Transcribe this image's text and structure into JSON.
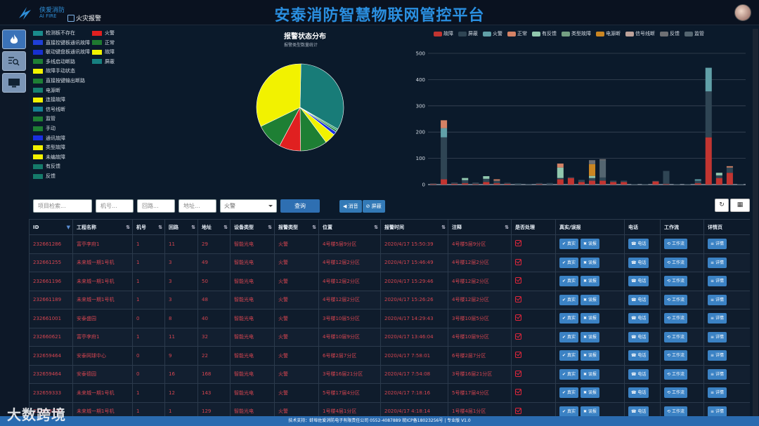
{
  "header": {
    "brand_line1": "侠爱消防",
    "brand_line2": "AI FIRE",
    "fire_alarm": "火灾报警",
    "title": "安泰消防智慧物联网管控平台"
  },
  "sidebar": {
    "items": [
      {
        "icon": "fire-icon",
        "active": true
      },
      {
        "icon": "list-search-icon",
        "active": false
      },
      {
        "icon": "monitor-icon",
        "active": false
      }
    ]
  },
  "pie_legend": [
    {
      "label": "检测板不存在",
      "color": "#1a8c8c"
    },
    {
      "label": "火警",
      "color": "#e02020"
    },
    {
      "label": "直接控键板通讯故障",
      "color": "#1f3fd6"
    },
    {
      "label": "正常",
      "color": "#1f7a30"
    },
    {
      "label": "联动键盘板通讯故障",
      "color": "#1730d0"
    },
    {
      "label": "故障",
      "color": "#f2f200"
    },
    {
      "label": "多线启动断路",
      "color": "#1e7f34"
    },
    {
      "label": "屏蔽",
      "color": "#178080"
    },
    {
      "label": "故障手动状态",
      "color": "#f2f200"
    },
    {
      "label": "直接按键输出断路",
      "color": "#1e7f34"
    },
    {
      "label": "电源断",
      "color": "#178070"
    },
    {
      "label": "连接故障",
      "color": "#f2f200"
    },
    {
      "label": "信号线断",
      "color": "#158090"
    },
    {
      "label": "监管",
      "color": "#1e7f34"
    },
    {
      "label": "手动",
      "color": "#1e7f34"
    },
    {
      "label": "通讯故障",
      "color": "#1a2fe0"
    },
    {
      "label": "类型故障",
      "color": "#f2f200"
    },
    {
      "label": "未编故障",
      "color": "#f2f200"
    },
    {
      "label": "有反馈",
      "color": "#157a6a"
    },
    {
      "label": "反馈",
      "color": "#157a6a"
    }
  ],
  "pie": {
    "title": "报警状态分布",
    "subtitle": "报警类型数量统计",
    "slices": [
      {
        "name": "屏蔽",
        "value": 33,
        "color": "#187c78"
      },
      {
        "name": "监管",
        "value": 0.6,
        "color": "#2aa060"
      },
      {
        "name": "正常",
        "value": 0.7,
        "color": "#1e7f34"
      },
      {
        "name": "通讯故障",
        "value": 1.2,
        "color": "#1a2fe0"
      },
      {
        "name": "故障",
        "value": 4,
        "color": "#f2f200"
      },
      {
        "name": "直接按键输出断路",
        "value": 10,
        "color": "#1e7f34"
      },
      {
        "name": "火警",
        "value": 8,
        "color": "#e02020"
      },
      {
        "name": "正常",
        "value": 10,
        "color": "#1e7f34"
      },
      {
        "name": "故障",
        "value": 32.5,
        "color": "#f2f200"
      }
    ]
  },
  "chart_data": {
    "type": "bar",
    "stacked": true,
    "ylim": [
      0,
      500
    ],
    "yticks": [
      "0",
      "100",
      "200",
      "300",
      "400",
      "500"
    ],
    "legend": [
      {
        "name": "故障",
        "color": "#c23531"
      },
      {
        "name": "屏蔽",
        "color": "#2f4554"
      },
      {
        "name": "火警",
        "color": "#61a0a8"
      },
      {
        "name": "正常",
        "color": "#d48265"
      },
      {
        "name": "有反馈",
        "color": "#91c7ae"
      },
      {
        "name": "类型故障",
        "color": "#749f83"
      },
      {
        "name": "电源断",
        "color": "#ca8622"
      },
      {
        "name": "信号线断",
        "color": "#bda29a"
      },
      {
        "name": "反馈",
        "color": "#6e7074"
      },
      {
        "name": "监管",
        "color": "#546570"
      }
    ],
    "categories": 30,
    "stacks": [
      [
        [
          0,
          2
        ],
        [
          1,
          3
        ]
      ],
      [
        [
          0,
          20
        ],
        [
          1,
          160
        ],
        [
          2,
          35
        ],
        [
          3,
          30
        ]
      ],
      [
        [
          0,
          3
        ],
        [
          1,
          5
        ]
      ],
      [
        [
          0,
          5
        ],
        [
          1,
          12
        ],
        [
          4,
          8
        ]
      ],
      [
        [
          0,
          2
        ],
        [
          1,
          6
        ]
      ],
      [
        [
          0,
          10
        ],
        [
          1,
          12
        ],
        [
          4,
          10
        ]
      ],
      [
        [
          0,
          5
        ],
        [
          1,
          10
        ],
        [
          3,
          5
        ]
      ],
      [
        [
          0,
          3
        ],
        [
          1,
          4
        ]
      ],
      [
        [
          1,
          5
        ]
      ],
      [
        [
          1,
          3
        ]
      ],
      [
        [
          0,
          2
        ],
        [
          1,
          4
        ]
      ],
      [
        [
          1,
          6
        ]
      ],
      [
        [
          0,
          20
        ],
        [
          1,
          5
        ],
        [
          4,
          40
        ],
        [
          3,
          15
        ]
      ],
      [
        [
          0,
          25
        ],
        [
          1,
          3
        ]
      ],
      [
        [
          0,
          10
        ],
        [
          1,
          8
        ]
      ],
      [
        [
          0,
          15
        ],
        [
          1,
          10
        ],
        [
          4,
          8
        ],
        [
          6,
          45
        ],
        [
          8,
          15
        ]
      ],
      [
        [
          0,
          15
        ],
        [
          1,
          12
        ],
        [
          9,
          65
        ],
        [
          8,
          5
        ]
      ],
      [
        [
          0,
          10
        ],
        [
          1,
          5
        ]
      ],
      [
        [
          0,
          10
        ],
        [
          1,
          5
        ]
      ],
      [
        [
          1,
          2
        ]
      ],
      [
        [
          1,
          2
        ]
      ],
      [
        [
          0,
          12
        ],
        [
          1,
          2
        ]
      ],
      [
        [
          0,
          2
        ],
        [
          1,
          50
        ]
      ],
      [
        [
          1,
          2
        ]
      ],
      [
        [
          1,
          2
        ]
      ],
      [
        [
          0,
          5
        ],
        [
          1,
          10
        ],
        [
          2,
          5
        ]
      ],
      [
        [
          0,
          180
        ],
        [
          1,
          175
        ],
        [
          2,
          90
        ]
      ],
      [
        [
          0,
          25
        ],
        [
          1,
          10
        ],
        [
          4,
          10
        ]
      ],
      [
        [
          0,
          45
        ],
        [
          1,
          20
        ],
        [
          3,
          5
        ]
      ],
      [
        [
          1,
          2
        ]
      ]
    ]
  },
  "filters": {
    "project_placeholder": "项目检索...",
    "machine_placeholder": "机号...",
    "loop_placeholder": "回路...",
    "address_placeholder": "地址...",
    "alarm_type": "火警",
    "query": "查询",
    "mute": "消音",
    "shield": "屏蔽",
    "refresh": "↻",
    "columns": "▦"
  },
  "table": {
    "headers": [
      "ID",
      "工程名称",
      "机号",
      "回路",
      "地址",
      "设备类型",
      "报警类型",
      "位置",
      "报警时间",
      "注释",
      "是否处理",
      "真实/误报",
      "电话",
      "工作流",
      "详情页"
    ],
    "rows": [
      [
        "232661286",
        "富亭李府1",
        "1",
        "11",
        "29",
        "智能光电",
        "火警",
        "4号楼5层9分区",
        "2020/4/17 15:50:39",
        "4号楼5层9分区"
      ],
      [
        "232661255",
        "未来城一期1号机",
        "1",
        "3",
        "49",
        "智能光电",
        "火警",
        "4号楼12层2分区",
        "2020/4/17 15:46:49",
        "4号楼12层2分区"
      ],
      [
        "232661196",
        "未来城一期1号机",
        "1",
        "3",
        "50",
        "智能光电",
        "火警",
        "4号楼12层2分区",
        "2020/4/17 15:29:46",
        "4号楼12层2分区"
      ],
      [
        "232661189",
        "未来城一期1号机",
        "1",
        "3",
        "48",
        "智能光电",
        "火警",
        "4号楼12层2分区",
        "2020/4/17 15:26:26",
        "4号楼12层2分区"
      ],
      [
        "232661001",
        "安泰盛园",
        "0",
        "8",
        "40",
        "智能光电",
        "火警",
        "3号楼10层5分区",
        "2020/4/17 14:29:43",
        "3号楼10层5分区"
      ],
      [
        "232660621",
        "富亭李府1",
        "1",
        "11",
        "32",
        "智能光电",
        "火警",
        "4号楼10层9分区",
        "2020/4/17 13:46:04",
        "4号楼10层9分区"
      ],
      [
        "232659464",
        "安泰网球中心",
        "0",
        "9",
        "22",
        "智能光电",
        "火警",
        "6号楼2层7分区",
        "2020/4/17 7:58:01",
        "6号楼2层7分区"
      ],
      [
        "232659464",
        "安泰德园",
        "0",
        "16",
        "168",
        "智能光电",
        "火警",
        "3号楼16层21分区",
        "2020/4/17 7:54:08",
        "3号楼16层21分区"
      ],
      [
        "232659333",
        "未来城一期1号机",
        "1",
        "12",
        "143",
        "智能光电",
        "火警",
        "5号楼17层4分区",
        "2020/4/17 7:18:16",
        "5号楼17层4分区"
      ],
      [
        "232659320",
        "未来城一期1号机",
        "1",
        "1",
        "129",
        "智能光电",
        "火警",
        "1号楼4层1分区",
        "2020/4/17 4:18:14",
        "1号楼4层1分区"
      ]
    ],
    "btn_real": "真实",
    "btn_false": "误报",
    "btn_phone": "电话",
    "btn_flow": "工作流",
    "btn_detail": "详情"
  },
  "footer": "技术支持：蚌埠佐爱消防电子有限责任公司 0552-4087889 皖ICP备18023256号 | 专业版 V1.0",
  "watermark": "大数跨境"
}
